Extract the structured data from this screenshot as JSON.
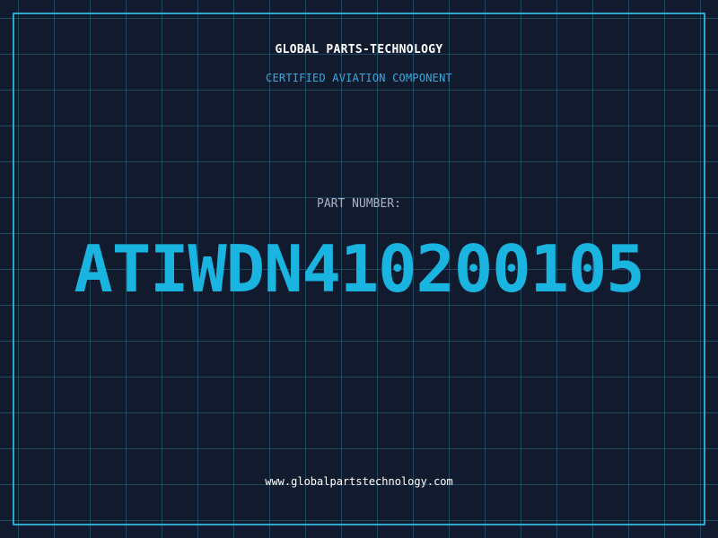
{
  "header": {
    "company": "GLOBAL PARTS-TECHNOLOGY",
    "tagline": "CERTIFIED AVIATION COMPONENT"
  },
  "part": {
    "label": "PART NUMBER:",
    "number": "ATIWDN410200105"
  },
  "footer": {
    "website": "www.globalpartstechnology.com"
  },
  "colors": {
    "background": "#121a2e",
    "grid": "#308caa",
    "frame": "#2aa5cc",
    "accent": "#1ab4e0",
    "tagline": "#3aa8dd",
    "label": "#a8b4c6",
    "text": "#ffffff"
  }
}
